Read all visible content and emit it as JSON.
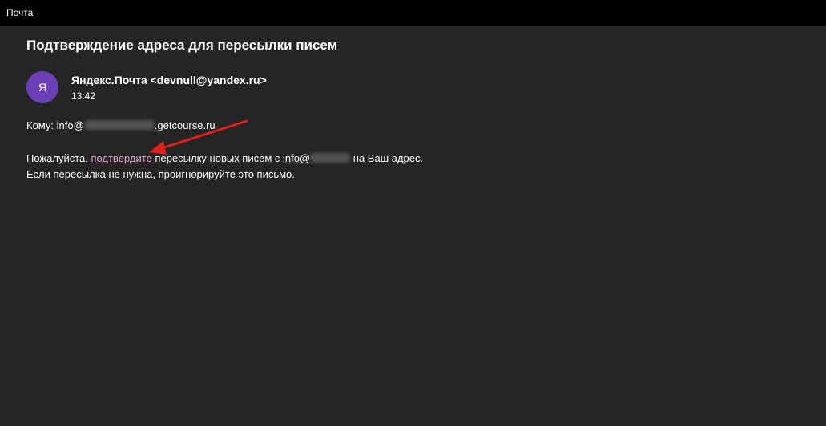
{
  "window": {
    "app_title": "Почта"
  },
  "message": {
    "subject": "Подтверждение адреса для пересылки писем",
    "avatar_letter": "Я",
    "avatar_color": "#6b3fb8",
    "sender": "Яндекс.Почта <devnull@yandex.ru>",
    "time": "13:42",
    "to_prefix": "Кому: info@",
    "to_suffix": ".getcourse.ru",
    "body_line1_before": "Пожалуйста, ",
    "confirm_link": "подтвердите",
    "body_line1_middle": " пересылку новых писем с ",
    "body_line1_email_start": "info@",
    "body_line1_after": " на Ваш адрес.",
    "body_line2": "Если пересылка не нужна, проигнорируйте это письмо."
  },
  "annotation": {
    "arrow_color": "#e0201c"
  }
}
